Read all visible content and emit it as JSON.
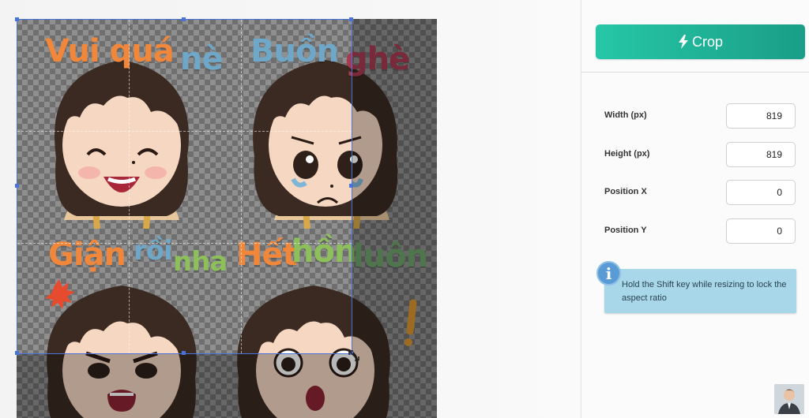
{
  "sticker_texts": {
    "happy": [
      "Vui quá",
      "nè"
    ],
    "sad": [
      "Buồn",
      "ghè"
    ],
    "angry": [
      "Giận",
      "rồi",
      "nha"
    ],
    "surprised": [
      "Hết",
      "hồn",
      "luôn"
    ]
  },
  "panel": {
    "crop_button_label": "Crop",
    "fields": [
      {
        "label": "Width (px)",
        "value": "819"
      },
      {
        "label": "Height (px)",
        "value": "819"
      },
      {
        "label": "Position X",
        "value": "0"
      },
      {
        "label": "Position Y",
        "value": "0"
      }
    ],
    "info_text": "Hold the Shift key while resizing to lock the aspect ratio"
  },
  "colors": {
    "crop_button": "#26c7a7",
    "crop_border": "#4a73d9",
    "info_bg": "#a9d7ea"
  }
}
